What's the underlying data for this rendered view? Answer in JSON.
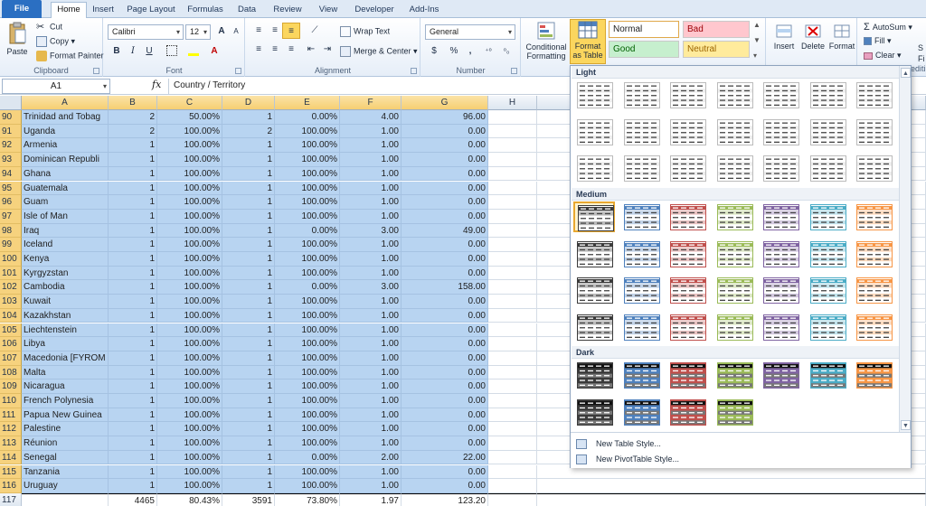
{
  "tabs": [
    "File",
    "Home",
    "Insert",
    "Page Layout",
    "Formulas",
    "Data",
    "Review",
    "View",
    "Developer",
    "Add-Ins"
  ],
  "active_tab": "Home",
  "clipboard": {
    "paste": "Paste",
    "cut": "Cut",
    "copy": "Copy",
    "format_painter": "Format Painter",
    "label": "Clipboard"
  },
  "font": {
    "name": "Calibri",
    "size": "12",
    "label": "Font",
    "bold": "B",
    "italic": "I",
    "underline": "U",
    "grow": "A",
    "shrink": "A"
  },
  "alignment": {
    "wrap": "Wrap Text",
    "merge": "Merge & Center",
    "label": "Alignment"
  },
  "number": {
    "format": "General",
    "currency": "$",
    "percent": "%",
    "comma": ",",
    "label": "Number"
  },
  "styles": {
    "conditional": "Conditional",
    "conditional2": "Formatting",
    "format_table": "Format",
    "format_table2": "as Table",
    "normal": "Normal",
    "bad": "Bad",
    "good": "Good",
    "neutral": "Neutral"
  },
  "cells": {
    "insert": "Insert",
    "delete": "Delete",
    "format": "Format"
  },
  "editing": {
    "autosum": "AutoSum",
    "fill": "Fill",
    "clear": "Clear",
    "partial1": "S",
    "partial2": "Fi",
    "partial3": "editi"
  },
  "formula_bar": {
    "name_box": "A1",
    "fx": "fx",
    "content": "Country / Territory"
  },
  "columns": [
    "A",
    "B",
    "C",
    "D",
    "E",
    "F",
    "G",
    "H",
    "I"
  ],
  "rows": [
    {
      "n": "90",
      "a": "Trinidad and Tobag",
      "b": "2",
      "c": "50.00%",
      "d": "1",
      "e": "0.00%",
      "f": "4.00",
      "g": "96.00"
    },
    {
      "n": "91",
      "a": "Uganda",
      "b": "2",
      "c": "100.00%",
      "d": "2",
      "e": "100.00%",
      "f": "1.00",
      "g": "0.00"
    },
    {
      "n": "92",
      "a": "Armenia",
      "b": "1",
      "c": "100.00%",
      "d": "1",
      "e": "100.00%",
      "f": "1.00",
      "g": "0.00"
    },
    {
      "n": "93",
      "a": "Dominican Republi",
      "b": "1",
      "c": "100.00%",
      "d": "1",
      "e": "100.00%",
      "f": "1.00",
      "g": "0.00"
    },
    {
      "n": "94",
      "a": "Ghana",
      "b": "1",
      "c": "100.00%",
      "d": "1",
      "e": "100.00%",
      "f": "1.00",
      "g": "0.00"
    },
    {
      "n": "95",
      "a": "Guatemala",
      "b": "1",
      "c": "100.00%",
      "d": "1",
      "e": "100.00%",
      "f": "1.00",
      "g": "0.00"
    },
    {
      "n": "96",
      "a": "Guam",
      "b": "1",
      "c": "100.00%",
      "d": "1",
      "e": "100.00%",
      "f": "1.00",
      "g": "0.00"
    },
    {
      "n": "97",
      "a": "Isle of Man",
      "b": "1",
      "c": "100.00%",
      "d": "1",
      "e": "100.00%",
      "f": "1.00",
      "g": "0.00"
    },
    {
      "n": "98",
      "a": "Iraq",
      "b": "1",
      "c": "100.00%",
      "d": "1",
      "e": "0.00%",
      "f": "3.00",
      "g": "49.00"
    },
    {
      "n": "99",
      "a": "Iceland",
      "b": "1",
      "c": "100.00%",
      "d": "1",
      "e": "100.00%",
      "f": "1.00",
      "g": "0.00"
    },
    {
      "n": "100",
      "a": "Kenya",
      "b": "1",
      "c": "100.00%",
      "d": "1",
      "e": "100.00%",
      "f": "1.00",
      "g": "0.00"
    },
    {
      "n": "101",
      "a": "Kyrgyzstan",
      "b": "1",
      "c": "100.00%",
      "d": "1",
      "e": "100.00%",
      "f": "1.00",
      "g": "0.00"
    },
    {
      "n": "102",
      "a": "Cambodia",
      "b": "1",
      "c": "100.00%",
      "d": "1",
      "e": "0.00%",
      "f": "3.00",
      "g": "158.00"
    },
    {
      "n": "103",
      "a": "Kuwait",
      "b": "1",
      "c": "100.00%",
      "d": "1",
      "e": "100.00%",
      "f": "1.00",
      "g": "0.00"
    },
    {
      "n": "104",
      "a": "Kazakhstan",
      "b": "1",
      "c": "100.00%",
      "d": "1",
      "e": "100.00%",
      "f": "1.00",
      "g": "0.00"
    },
    {
      "n": "105",
      "a": "Liechtenstein",
      "b": "1",
      "c": "100.00%",
      "d": "1",
      "e": "100.00%",
      "f": "1.00",
      "g": "0.00"
    },
    {
      "n": "106",
      "a": "Libya",
      "b": "1",
      "c": "100.00%",
      "d": "1",
      "e": "100.00%",
      "f": "1.00",
      "g": "0.00"
    },
    {
      "n": "107",
      "a": "Macedonia [FYROM",
      "b": "1",
      "c": "100.00%",
      "d": "1",
      "e": "100.00%",
      "f": "1.00",
      "g": "0.00"
    },
    {
      "n": "108",
      "a": "Malta",
      "b": "1",
      "c": "100.00%",
      "d": "1",
      "e": "100.00%",
      "f": "1.00",
      "g": "0.00"
    },
    {
      "n": "109",
      "a": "Nicaragua",
      "b": "1",
      "c": "100.00%",
      "d": "1",
      "e": "100.00%",
      "f": "1.00",
      "g": "0.00"
    },
    {
      "n": "110",
      "a": "French Polynesia",
      "b": "1",
      "c": "100.00%",
      "d": "1",
      "e": "100.00%",
      "f": "1.00",
      "g": "0.00"
    },
    {
      "n": "111",
      "a": "Papua New Guinea",
      "b": "1",
      "c": "100.00%",
      "d": "1",
      "e": "100.00%",
      "f": "1.00",
      "g": "0.00"
    },
    {
      "n": "112",
      "a": "Palestine",
      "b": "1",
      "c": "100.00%",
      "d": "1",
      "e": "100.00%",
      "f": "1.00",
      "g": "0.00"
    },
    {
      "n": "113",
      "a": "Réunion",
      "b": "1",
      "c": "100.00%",
      "d": "1",
      "e": "100.00%",
      "f": "1.00",
      "g": "0.00"
    },
    {
      "n": "114",
      "a": "Senegal",
      "b": "1",
      "c": "100.00%",
      "d": "1",
      "e": "0.00%",
      "f": "2.00",
      "g": "22.00"
    },
    {
      "n": "115",
      "a": "Tanzania",
      "b": "1",
      "c": "100.00%",
      "d": "1",
      "e": "100.00%",
      "f": "1.00",
      "g": "0.00"
    },
    {
      "n": "116",
      "a": "Uruguay",
      "b": "1",
      "c": "100.00%",
      "d": "1",
      "e": "100.00%",
      "f": "1.00",
      "g": "0.00"
    }
  ],
  "total_row": {
    "n": "117",
    "a": "",
    "b": "4465",
    "c": "80.43%",
    "d": "3591",
    "e": "73.80%",
    "f": "1.97",
    "g": "123.20"
  },
  "gallery": {
    "sections": [
      "Light",
      "Medium",
      "Dark"
    ],
    "new_table_style": "New Table Style...",
    "new_pivot_style": "New PivotTable Style...",
    "palette": [
      "#3b3b3b",
      "#4f81bd",
      "#c0504d",
      "#9bbb59",
      "#8064a2",
      "#4bacc6",
      "#f79646"
    ]
  }
}
